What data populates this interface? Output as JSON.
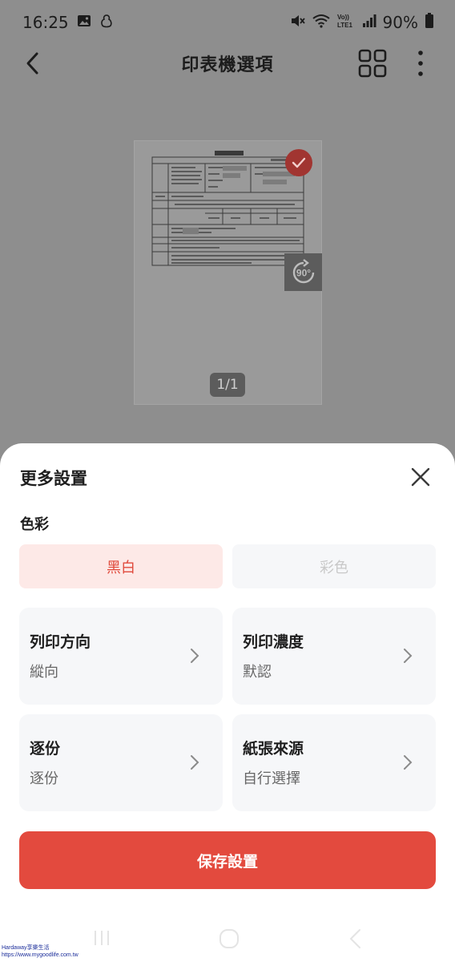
{
  "status_bar": {
    "time": "16:25",
    "battery": "90%",
    "network": "LTE1"
  },
  "header": {
    "title": "印表機選項"
  },
  "preview": {
    "page_indicator": "1/1",
    "rotate_label": "90°"
  },
  "sheet": {
    "title": "更多設置",
    "color_section_label": "色彩",
    "color_options": [
      {
        "label": "黑白",
        "selected": true
      },
      {
        "label": "彩色",
        "selected": false
      }
    ],
    "settings": [
      {
        "title": "列印方向",
        "value": "縱向"
      },
      {
        "title": "列印濃度",
        "value": "默認"
      },
      {
        "title": "逐份",
        "value": "逐份"
      },
      {
        "title": "紙張來源",
        "value": "自行選擇"
      }
    ],
    "save_label": "保存設置"
  },
  "watermark": {
    "line1": "Hardaway享樂生活",
    "line2": "https://www.mygoodlife.com.tw"
  },
  "colors": {
    "accent": "#e34a3e",
    "selected_bg": "#fde9e7",
    "card_bg": "#f6f7f9",
    "scrim": "#8e8e8e"
  }
}
